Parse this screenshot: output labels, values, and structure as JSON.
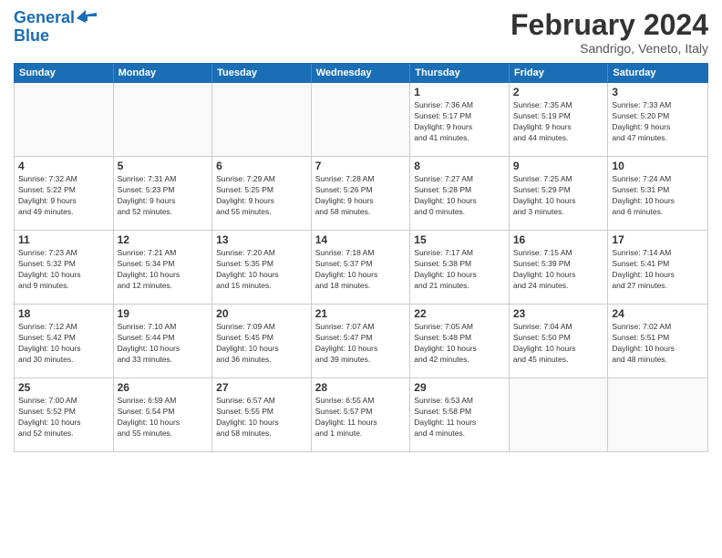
{
  "header": {
    "logo_line1": "General",
    "logo_line2": "Blue",
    "month_title": "February 2024",
    "subtitle": "Sandrigo, Veneto, Italy"
  },
  "days_of_week": [
    "Sunday",
    "Monday",
    "Tuesday",
    "Wednesday",
    "Thursday",
    "Friday",
    "Saturday"
  ],
  "weeks": [
    [
      {
        "day": "",
        "info": ""
      },
      {
        "day": "",
        "info": ""
      },
      {
        "day": "",
        "info": ""
      },
      {
        "day": "",
        "info": ""
      },
      {
        "day": "1",
        "info": "Sunrise: 7:36 AM\nSunset: 5:17 PM\nDaylight: 9 hours\nand 41 minutes."
      },
      {
        "day": "2",
        "info": "Sunrise: 7:35 AM\nSunset: 5:19 PM\nDaylight: 9 hours\nand 44 minutes."
      },
      {
        "day": "3",
        "info": "Sunrise: 7:33 AM\nSunset: 5:20 PM\nDaylight: 9 hours\nand 47 minutes."
      }
    ],
    [
      {
        "day": "4",
        "info": "Sunrise: 7:32 AM\nSunset: 5:22 PM\nDaylight: 9 hours\nand 49 minutes."
      },
      {
        "day": "5",
        "info": "Sunrise: 7:31 AM\nSunset: 5:23 PM\nDaylight: 9 hours\nand 52 minutes."
      },
      {
        "day": "6",
        "info": "Sunrise: 7:29 AM\nSunset: 5:25 PM\nDaylight: 9 hours\nand 55 minutes."
      },
      {
        "day": "7",
        "info": "Sunrise: 7:28 AM\nSunset: 5:26 PM\nDaylight: 9 hours\nand 58 minutes."
      },
      {
        "day": "8",
        "info": "Sunrise: 7:27 AM\nSunset: 5:28 PM\nDaylight: 10 hours\nand 0 minutes."
      },
      {
        "day": "9",
        "info": "Sunrise: 7:25 AM\nSunset: 5:29 PM\nDaylight: 10 hours\nand 3 minutes."
      },
      {
        "day": "10",
        "info": "Sunrise: 7:24 AM\nSunset: 5:31 PM\nDaylight: 10 hours\nand 6 minutes."
      }
    ],
    [
      {
        "day": "11",
        "info": "Sunrise: 7:23 AM\nSunset: 5:32 PM\nDaylight: 10 hours\nand 9 minutes."
      },
      {
        "day": "12",
        "info": "Sunrise: 7:21 AM\nSunset: 5:34 PM\nDaylight: 10 hours\nand 12 minutes."
      },
      {
        "day": "13",
        "info": "Sunrise: 7:20 AM\nSunset: 5:35 PM\nDaylight: 10 hours\nand 15 minutes."
      },
      {
        "day": "14",
        "info": "Sunrise: 7:18 AM\nSunset: 5:37 PM\nDaylight: 10 hours\nand 18 minutes."
      },
      {
        "day": "15",
        "info": "Sunrise: 7:17 AM\nSunset: 5:38 PM\nDaylight: 10 hours\nand 21 minutes."
      },
      {
        "day": "16",
        "info": "Sunrise: 7:15 AM\nSunset: 5:39 PM\nDaylight: 10 hours\nand 24 minutes."
      },
      {
        "day": "17",
        "info": "Sunrise: 7:14 AM\nSunset: 5:41 PM\nDaylight: 10 hours\nand 27 minutes."
      }
    ],
    [
      {
        "day": "18",
        "info": "Sunrise: 7:12 AM\nSunset: 5:42 PM\nDaylight: 10 hours\nand 30 minutes."
      },
      {
        "day": "19",
        "info": "Sunrise: 7:10 AM\nSunset: 5:44 PM\nDaylight: 10 hours\nand 33 minutes."
      },
      {
        "day": "20",
        "info": "Sunrise: 7:09 AM\nSunset: 5:45 PM\nDaylight: 10 hours\nand 36 minutes."
      },
      {
        "day": "21",
        "info": "Sunrise: 7:07 AM\nSunset: 5:47 PM\nDaylight: 10 hours\nand 39 minutes."
      },
      {
        "day": "22",
        "info": "Sunrise: 7:05 AM\nSunset: 5:48 PM\nDaylight: 10 hours\nand 42 minutes."
      },
      {
        "day": "23",
        "info": "Sunrise: 7:04 AM\nSunset: 5:50 PM\nDaylight: 10 hours\nand 45 minutes."
      },
      {
        "day": "24",
        "info": "Sunrise: 7:02 AM\nSunset: 5:51 PM\nDaylight: 10 hours\nand 48 minutes."
      }
    ],
    [
      {
        "day": "25",
        "info": "Sunrise: 7:00 AM\nSunset: 5:52 PM\nDaylight: 10 hours\nand 52 minutes."
      },
      {
        "day": "26",
        "info": "Sunrise: 6:59 AM\nSunset: 5:54 PM\nDaylight: 10 hours\nand 55 minutes."
      },
      {
        "day": "27",
        "info": "Sunrise: 6:57 AM\nSunset: 5:55 PM\nDaylight: 10 hours\nand 58 minutes."
      },
      {
        "day": "28",
        "info": "Sunrise: 6:55 AM\nSunset: 5:57 PM\nDaylight: 11 hours\nand 1 minute."
      },
      {
        "day": "29",
        "info": "Sunrise: 6:53 AM\nSunset: 5:58 PM\nDaylight: 11 hours\nand 4 minutes."
      },
      {
        "day": "",
        "info": ""
      },
      {
        "day": "",
        "info": ""
      }
    ]
  ]
}
